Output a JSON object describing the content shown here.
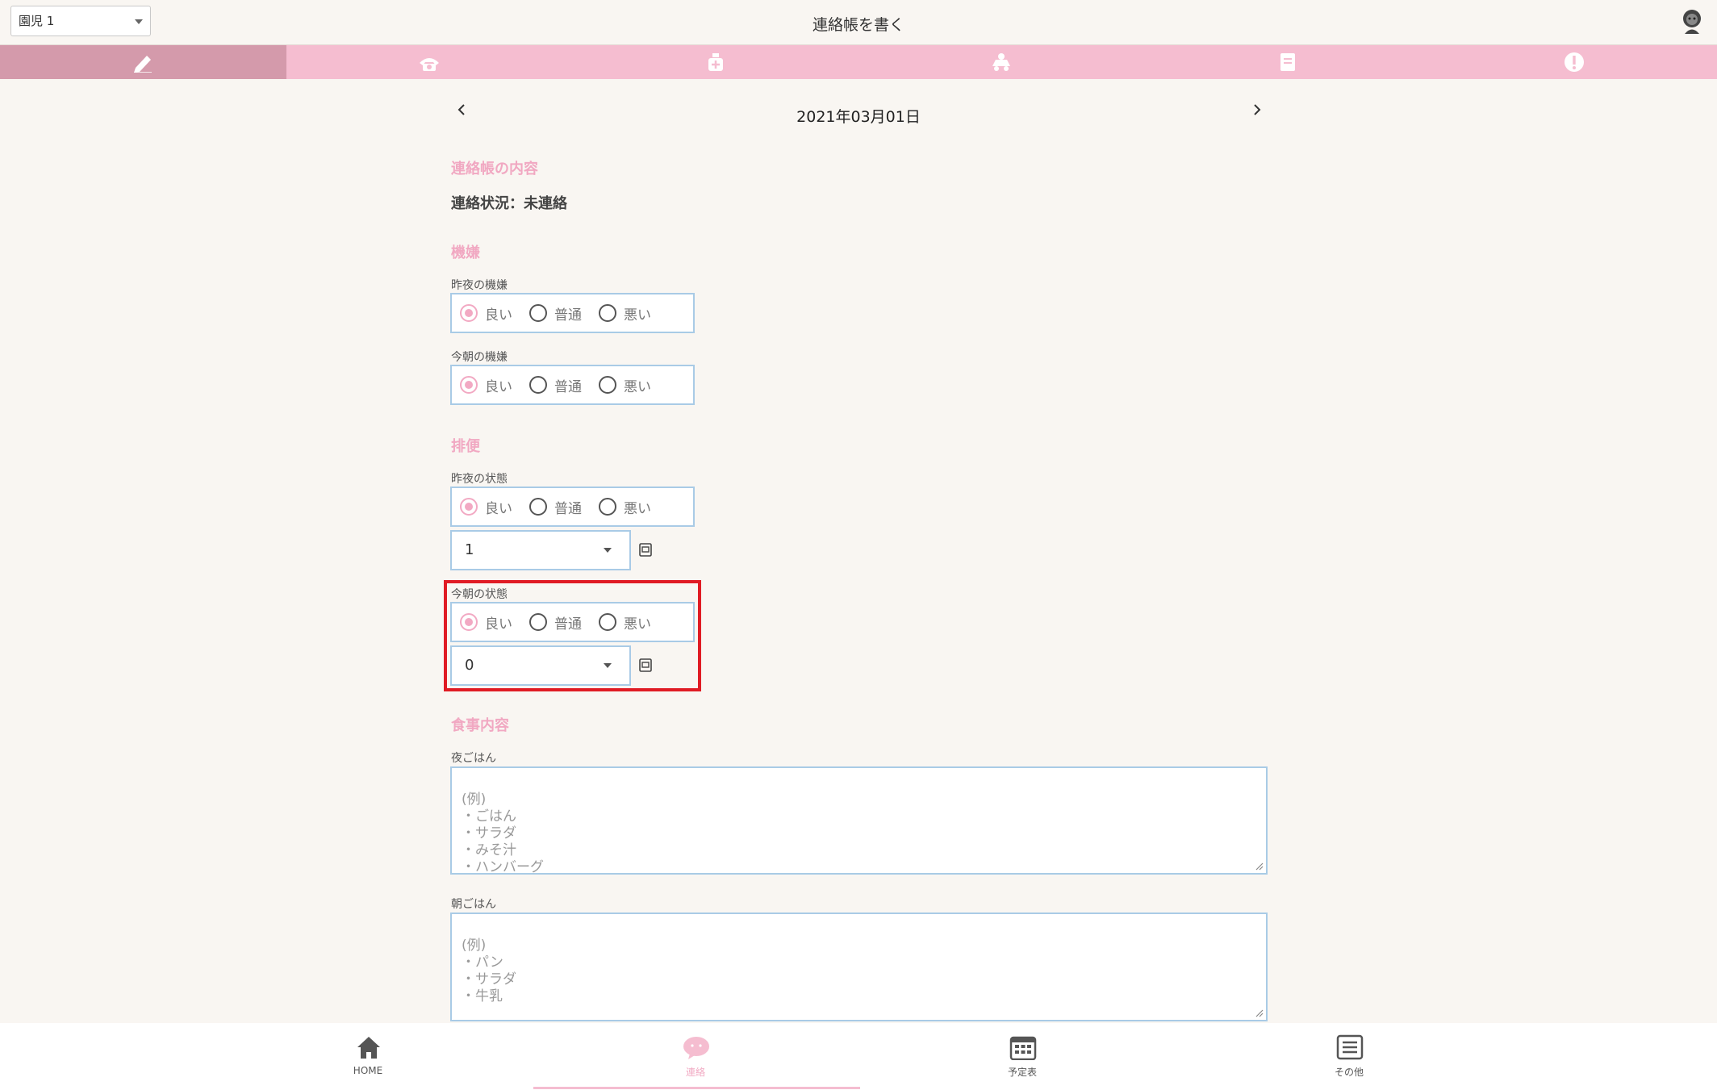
{
  "header": {
    "child_selector": "園児 1",
    "title": "連絡帳を書く"
  },
  "tabs": [
    {
      "icon": "pencil-icon",
      "active": true
    },
    {
      "icon": "telephone-icon",
      "active": false
    },
    {
      "icon": "medicine-icon",
      "active": false
    },
    {
      "icon": "pickup-icon",
      "active": false
    },
    {
      "icon": "notice-board-icon",
      "active": false
    },
    {
      "icon": "alert-icon",
      "active": false
    }
  ],
  "date_nav": {
    "date": "2021年03月01日"
  },
  "contact": {
    "section_title": "連絡帳の内容",
    "status": "連絡状況：未連絡"
  },
  "mood": {
    "section_title": "機嫌",
    "last_night": {
      "label": "昨夜の機嫌",
      "options": [
        "良い",
        "普通",
        "悪い"
      ],
      "selected": "良い"
    },
    "this_morning": {
      "label": "今朝の機嫌",
      "options": [
        "良い",
        "普通",
        "悪い"
      ],
      "selected": "良い"
    }
  },
  "bowel": {
    "section_title": "排便",
    "last_night": {
      "label": "昨夜の状態",
      "options": [
        "良い",
        "普通",
        "悪い"
      ],
      "selected": "良い",
      "count": "1"
    },
    "this_morning": {
      "label": "今朝の状態",
      "options": [
        "良い",
        "普通",
        "悪い"
      ],
      "selected": "良い",
      "count": "0"
    }
  },
  "meals": {
    "section_title": "食事内容",
    "dinner": {
      "label": "夜ごはん",
      "placeholder": "(例)\n・ごはん\n・サラダ\n・みそ汁\n・ハンバーグ"
    },
    "breakfast": {
      "label": "朝ごはん",
      "placeholder": "(例)\n・パン\n・サラダ\n・牛乳"
    }
  },
  "bottom_nav": [
    {
      "label": "HOME",
      "icon": "home-icon",
      "active": false
    },
    {
      "label": "連絡",
      "icon": "chat-icon",
      "active": true
    },
    {
      "label": "予定表",
      "icon": "calendar-icon",
      "active": false
    },
    {
      "label": "その他",
      "icon": "menu-icon",
      "active": false
    }
  ],
  "colors": {
    "background": "#f9f6f2",
    "tab_bar": "#f5bdd0",
    "tab_active": "#d49aab",
    "accent_pink": "#f1a8c2",
    "field_border": "#a9cbe6",
    "highlight_red": "#e01b24"
  }
}
